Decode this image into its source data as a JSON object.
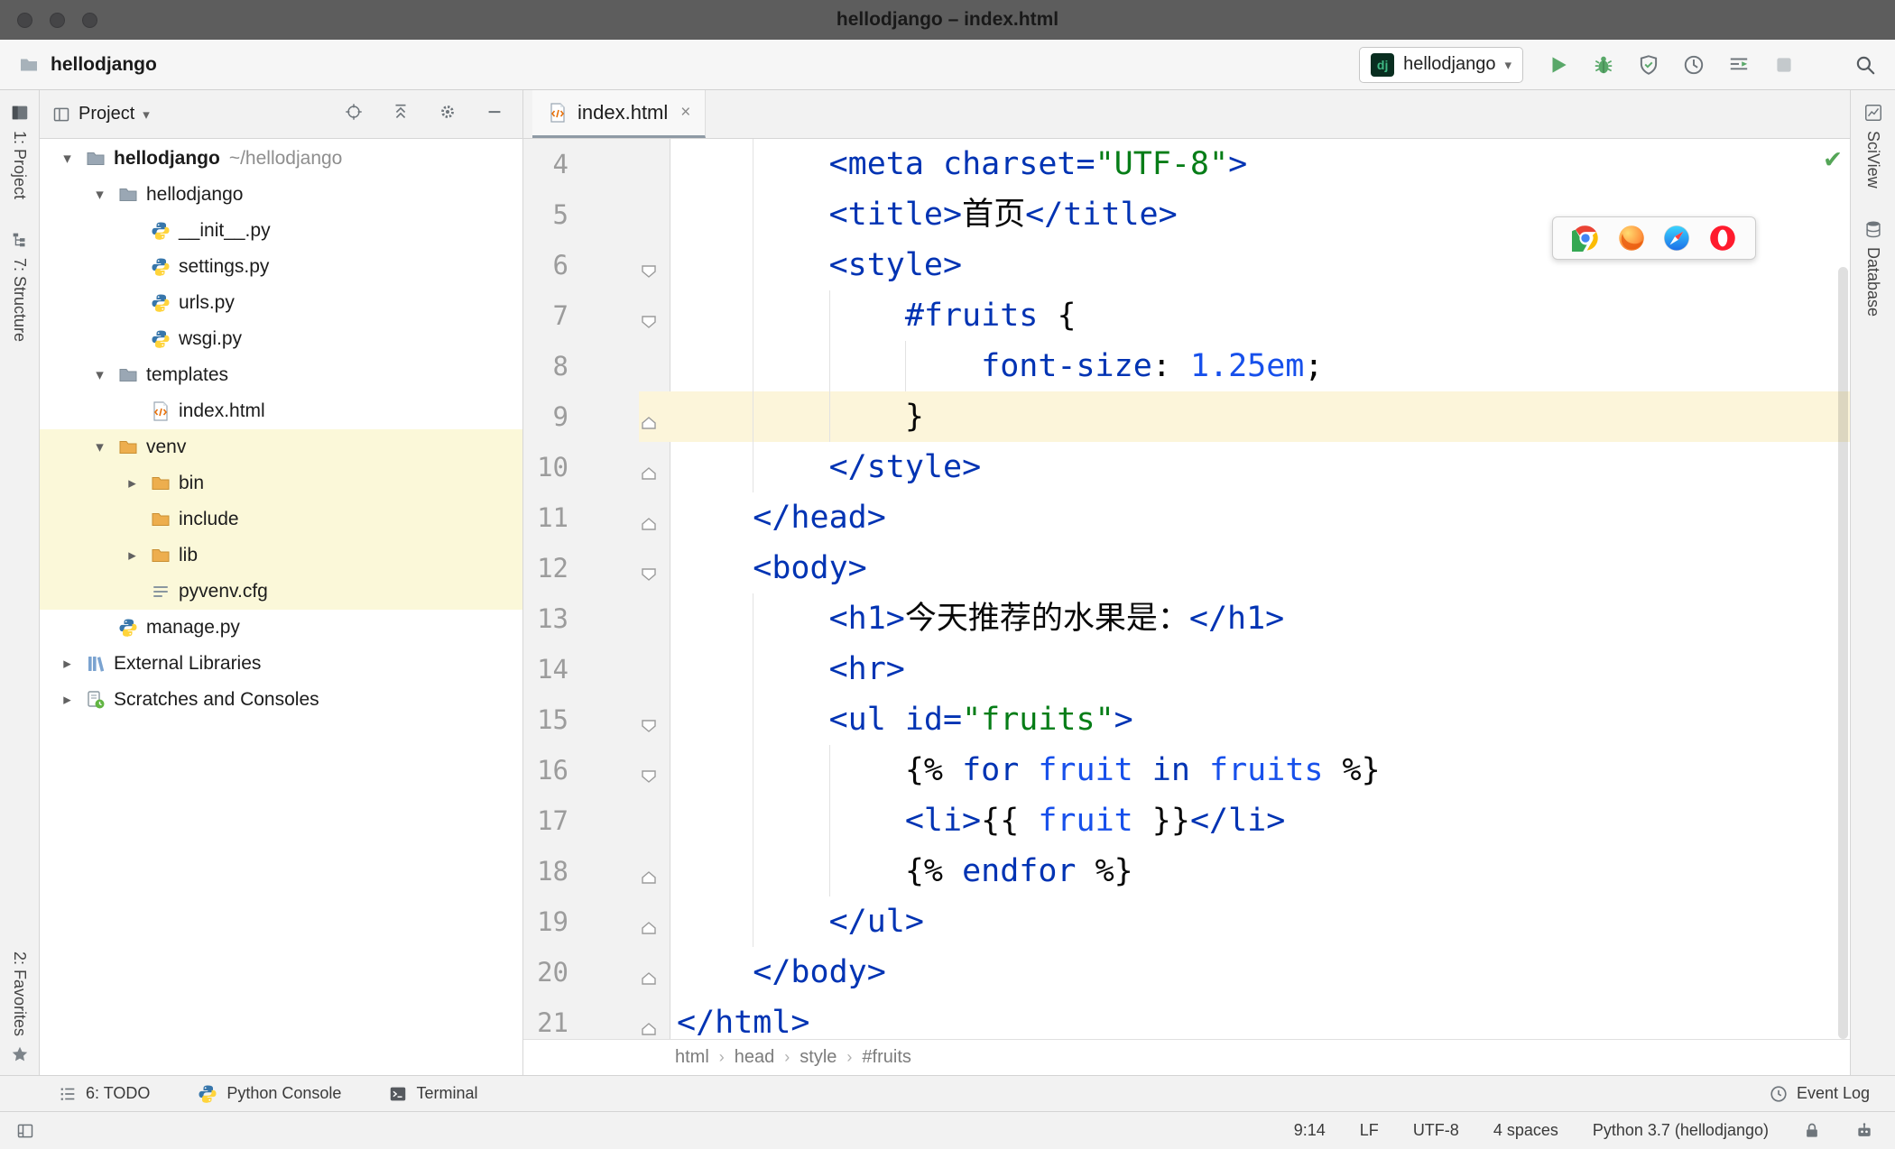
{
  "window": {
    "title": "hellodjango – index.html"
  },
  "glyphs": {
    "chevron_down": "▾",
    "expand_open": "▾",
    "expand_closed": "▸",
    "close_tab": "×",
    "inspection_ok": "✔",
    "crumb_sep": "›"
  },
  "toolbar": {
    "project_name": "hellodjango",
    "run_config_icon_text": "dj",
    "run_config_name": "hellodjango",
    "actions": [
      {
        "name": "run",
        "icon": "run-icon"
      },
      {
        "name": "debug",
        "icon": "debug-icon"
      },
      {
        "name": "run-with-coverage",
        "icon": "coverage-icon"
      },
      {
        "name": "profile",
        "icon": "profiler-icon"
      },
      {
        "name": "concurrency-diagram",
        "icon": "concurrency-icon"
      },
      {
        "name": "stop",
        "icon": "stop-icon"
      },
      {
        "name": "search-everywhere",
        "icon": "search-icon"
      }
    ]
  },
  "left_strip": {
    "top": [
      {
        "label": "1: Project",
        "icon": "project"
      },
      {
        "label": "7: Structure",
        "icon": "structure"
      }
    ],
    "bottom": [
      {
        "label": "2: Favorites",
        "icon": "favorites"
      }
    ]
  },
  "right_strip": [
    {
      "label": "SciView",
      "icon": "sciview"
    },
    {
      "label": "Database",
      "icon": "database"
    }
  ],
  "project_panel": {
    "title": "Project",
    "header_icons": [
      "locate",
      "collapse-all",
      "settings",
      "hide"
    ],
    "tree": [
      {
        "label": "hellodjango",
        "suffix": "~/hellodjango",
        "level": 0,
        "icon": "folder",
        "arrow": "open",
        "bold": true
      },
      {
        "label": "hellodjango",
        "level": 1,
        "icon": "folder",
        "arrow": "open"
      },
      {
        "label": "__init__.py",
        "level": 2,
        "icon": "python"
      },
      {
        "label": "settings.py",
        "level": 2,
        "icon": "python"
      },
      {
        "label": "urls.py",
        "level": 2,
        "icon": "python"
      },
      {
        "label": "wsgi.py",
        "level": 2,
        "icon": "python"
      },
      {
        "label": "templates",
        "level": 1,
        "icon": "folder",
        "arrow": "open"
      },
      {
        "label": "index.html",
        "level": 2,
        "icon": "html"
      },
      {
        "label": "venv",
        "level": 1,
        "icon": "folder-ex",
        "arrow": "open",
        "hl": true
      },
      {
        "label": "bin",
        "level": 2,
        "icon": "folder-ex",
        "arrow": "closed",
        "hl": true
      },
      {
        "label": "include",
        "level": 2,
        "icon": "folder-ex",
        "hl": true
      },
      {
        "label": "lib",
        "level": 2,
        "icon": "folder-ex",
        "arrow": "closed",
        "hl": true
      },
      {
        "label": "pyvenv.cfg",
        "level": 2,
        "icon": "cfg",
        "hl": true
      },
      {
        "label": "manage.py",
        "level": 1,
        "icon": "python"
      },
      {
        "label": "External Libraries",
        "level": 0,
        "icon": "libs",
        "arrow": "closed"
      },
      {
        "label": "Scratches and Consoles",
        "level": 0,
        "icon": "scratch",
        "arrow": "closed"
      }
    ]
  },
  "editor": {
    "tab": "index.html",
    "first_visible_line": 4,
    "current_line": 9,
    "breadcrumbs": [
      "html",
      "head",
      "style",
      "#fruits"
    ],
    "lines": [
      {
        "n": 4,
        "indent": 2,
        "fold": null,
        "tokens": [
          [
            "tag",
            "<meta"
          ],
          [
            "attr",
            " charset="
          ],
          [
            "str",
            "\"UTF-8\""
          ],
          [
            "tag",
            ">"
          ]
        ]
      },
      {
        "n": 5,
        "indent": 2,
        "fold": null,
        "tokens": [
          [
            "tag",
            "<title>"
          ],
          [
            "txt",
            "首页"
          ],
          [
            "tag",
            "</title>"
          ]
        ]
      },
      {
        "n": 6,
        "indent": 2,
        "fold": "down",
        "tokens": [
          [
            "tag",
            "<style>"
          ]
        ]
      },
      {
        "n": 7,
        "indent": 3,
        "fold": "down",
        "tokens": [
          [
            "sel",
            "#fruits"
          ],
          [
            "txt",
            " "
          ],
          [
            "punct",
            "{"
          ]
        ]
      },
      {
        "n": 8,
        "indent": 4,
        "fold": null,
        "tokens": [
          [
            "prop",
            "font-size"
          ],
          [
            "punct",
            ": "
          ],
          [
            "num",
            "1.25em"
          ],
          [
            "punct",
            ";"
          ]
        ]
      },
      {
        "n": 9,
        "indent": 3,
        "fold": "up",
        "cur": true,
        "tokens": [
          [
            "punct",
            "}"
          ]
        ]
      },
      {
        "n": 10,
        "indent": 2,
        "fold": "up",
        "tokens": [
          [
            "tag",
            "</style>"
          ]
        ]
      },
      {
        "n": 11,
        "indent": 1,
        "fold": "up",
        "tokens": [
          [
            "tag",
            "</head>"
          ]
        ]
      },
      {
        "n": 12,
        "indent": 1,
        "fold": "down",
        "tokens": [
          [
            "tag",
            "<body>"
          ]
        ]
      },
      {
        "n": 13,
        "indent": 2,
        "fold": null,
        "tokens": [
          [
            "tag",
            "<h1>"
          ],
          [
            "txt",
            "今天推荐的水果是："
          ],
          [
            "tag",
            "</h1>"
          ]
        ]
      },
      {
        "n": 14,
        "indent": 2,
        "fold": null,
        "tokens": [
          [
            "tag",
            "<hr>"
          ]
        ]
      },
      {
        "n": 15,
        "indent": 2,
        "fold": "down",
        "tokens": [
          [
            "tag",
            "<ul"
          ],
          [
            "attr",
            " id="
          ],
          [
            "str",
            "\"fruits\""
          ],
          [
            "tag",
            ">"
          ]
        ]
      },
      {
        "n": 16,
        "indent": 3,
        "fold": "down",
        "tokens": [
          [
            "punct",
            "{% "
          ],
          [
            "kw",
            "for"
          ],
          [
            "txt",
            " "
          ],
          [
            "var",
            "fruit"
          ],
          [
            "txt",
            " "
          ],
          [
            "kw",
            "in"
          ],
          [
            "txt",
            " "
          ],
          [
            "var",
            "fruits"
          ],
          [
            "punct",
            " %}"
          ]
        ]
      },
      {
        "n": 17,
        "indent": 3,
        "fold": null,
        "tokens": [
          [
            "tag",
            "<li>"
          ],
          [
            "punct",
            "{{ "
          ],
          [
            "var",
            "fruit"
          ],
          [
            "punct",
            " }}"
          ],
          [
            "tag",
            "</li>"
          ]
        ]
      },
      {
        "n": 18,
        "indent": 3,
        "fold": "up",
        "tokens": [
          [
            "punct",
            "{% "
          ],
          [
            "kw",
            "endfor"
          ],
          [
            "punct",
            " %}"
          ]
        ]
      },
      {
        "n": 19,
        "indent": 2,
        "fold": "up",
        "tokens": [
          [
            "tag",
            "</ul>"
          ]
        ]
      },
      {
        "n": 20,
        "indent": 1,
        "fold": "up",
        "tokens": [
          [
            "tag",
            "</body>"
          ]
        ]
      },
      {
        "n": 21,
        "indent": 0,
        "fold": "up",
        "tokens": [
          [
            "tag",
            "</html>"
          ]
        ]
      }
    ]
  },
  "browser_toolbar": [
    "chrome",
    "firefox",
    "safari",
    "opera"
  ],
  "bottom_bar": {
    "left": [
      {
        "label": "6: TODO",
        "icon": "todo"
      },
      {
        "label": "Python Console",
        "icon": "python"
      },
      {
        "label": "Terminal",
        "icon": "terminal"
      }
    ],
    "right": [
      {
        "label": "Event Log",
        "icon": "eventlog"
      }
    ]
  },
  "status_bar": {
    "items": [
      "9:14",
      "LF",
      "UTF-8",
      "4 spaces",
      "Python 3.7 (hellodjango)"
    ],
    "icons": [
      "lock",
      "hector"
    ]
  },
  "colors": {
    "accent_green": "#59a869",
    "caret_line_bg": "#fcf5da",
    "excluded_row_bg": "#fbf8d9",
    "tag_blue": "#0033b3",
    "string_green": "#067d17",
    "titlebar_gray": "#5d5d5d"
  }
}
